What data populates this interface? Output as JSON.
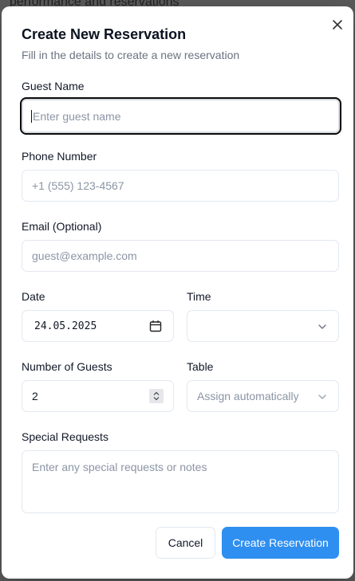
{
  "backdrop": {
    "text": "performance and reservations"
  },
  "dialog": {
    "title": "Create New Reservation",
    "subtitle": "Fill in the details to create a new reservation"
  },
  "form": {
    "guest_name": {
      "label": "Guest Name",
      "placeholder": "Enter guest name",
      "value": ""
    },
    "phone": {
      "label": "Phone Number",
      "placeholder": "+1 (555) 123-4567",
      "value": ""
    },
    "email": {
      "label": "Email (Optional)",
      "placeholder": "guest@example.com",
      "value": ""
    },
    "date": {
      "label": "Date",
      "value": "24.05.2025"
    },
    "time": {
      "label": "Time",
      "value": ""
    },
    "guests": {
      "label": "Number of Guests",
      "value": "2"
    },
    "table": {
      "label": "Table",
      "value": "Assign automatically"
    },
    "special_requests": {
      "label": "Special Requests",
      "placeholder": "Enter any special requests or notes",
      "value": ""
    }
  },
  "actions": {
    "cancel_label": "Cancel",
    "submit_label": "Create Reservation"
  },
  "colors": {
    "primary": "#2e8ff0",
    "border": "#e2e8f0",
    "muted": "#6b7280"
  },
  "icons": [
    "close-icon",
    "calendar-icon",
    "chevron-down-icon",
    "spinner-icon"
  ]
}
